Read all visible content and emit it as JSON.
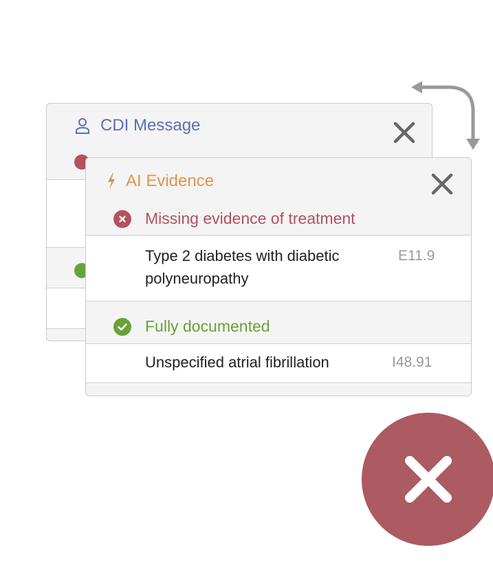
{
  "cdi_card": {
    "title": "CDI Message",
    "icons": {
      "title": "person-icon",
      "close": "close-icon"
    }
  },
  "ai_card": {
    "title": "AI Evidence",
    "icons": {
      "title": "lightning-bolt-icon",
      "close": "close-icon"
    },
    "sections": [
      {
        "status_label": "Missing evidence of treatment",
        "status_icon": "error-circle-icon",
        "status_color": "#b5505f",
        "items": [
          {
            "description_line1": "Type 2 diabetes with diabetic",
            "description_line2": "polyneuropathy",
            "code": "E11.9"
          }
        ]
      },
      {
        "status_label": "Fully documented",
        "status_icon": "check-circle-icon",
        "status_color": "#6aa13a",
        "items": [
          {
            "description_line1": "Unspecified atrial fibrillation",
            "code": "I48.91"
          }
        ]
      }
    ]
  },
  "colors": {
    "cdi_title": "#5a6fb5",
    "ai_title": "#e0954c",
    "dismiss_button": "#ab5b61",
    "arrow": "#999999"
  },
  "controls": {
    "dismiss_icon": "close-icon",
    "swap_icon": "swap-arrow-icon"
  }
}
